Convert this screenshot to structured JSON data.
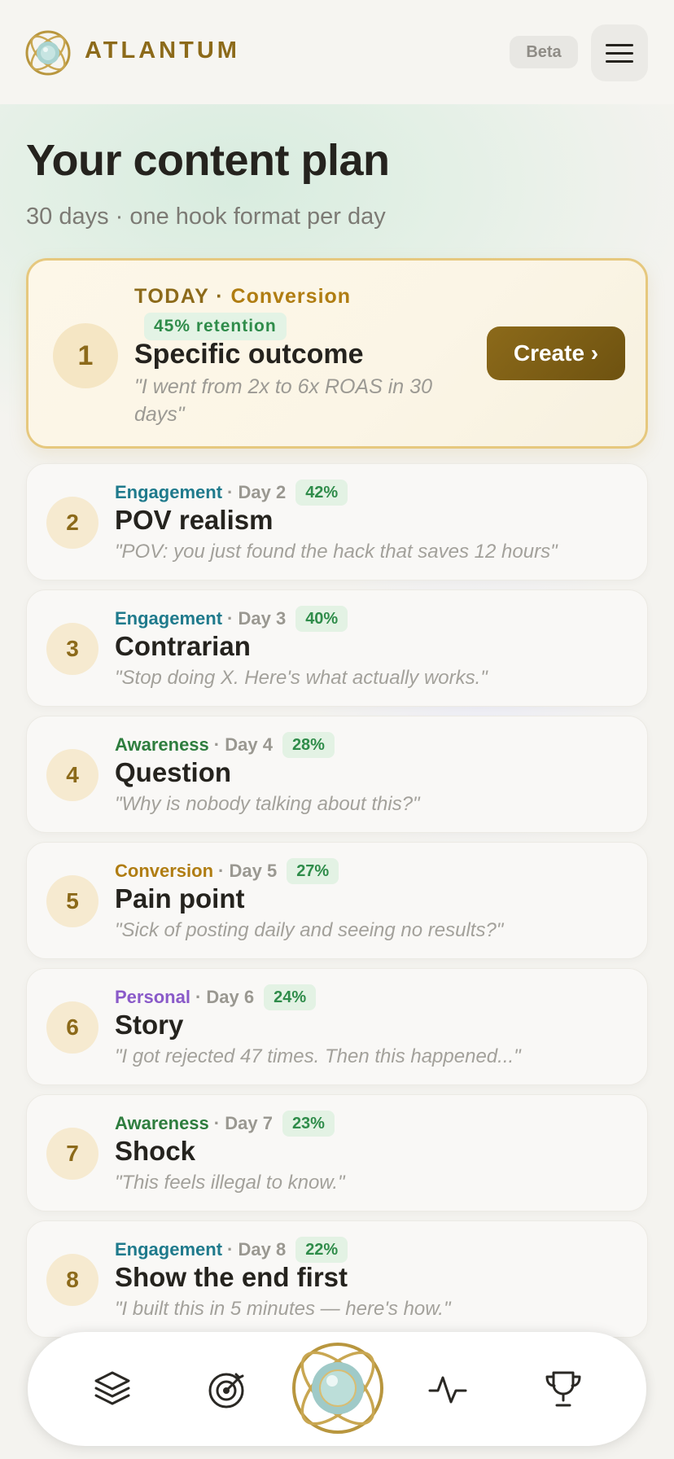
{
  "header": {
    "brand": "ATLANTUM",
    "beta_label": "Beta",
    "menu_icon": "hamburger-icon",
    "logo_icon": "atlantum-orb-logo"
  },
  "page": {
    "title": "Your content plan",
    "subtitle": "30 days · one hook format per day"
  },
  "today": {
    "number": "1",
    "label": "TODAY · ",
    "category": "Conversion",
    "retention": "45% retention",
    "name": "Specific outcome",
    "quote": "\"I went from 2x to 6x ROAS in 30 days\"",
    "cta": "Create ›"
  },
  "days": [
    {
      "number": "2",
      "category": "Engagement",
      "day": "· Day 2",
      "pct": "42%",
      "name": "POV realism",
      "quote": "\"POV: you just found the hack that saves 12 hours\""
    },
    {
      "number": "3",
      "category": "Engagement",
      "day": "· Day 3",
      "pct": "40%",
      "name": "Contrarian",
      "quote": "\"Stop doing X. Here's what actually works.\""
    },
    {
      "number": "4",
      "category": "Awareness",
      "day": "· Day 4",
      "pct": "28%",
      "name": "Question",
      "quote": "\"Why is nobody talking about this?\""
    },
    {
      "number": "5",
      "category": "Conversion",
      "day": "· Day 5",
      "pct": "27%",
      "name": "Pain point",
      "quote": "\"Sick of posting daily and seeing no results?\""
    },
    {
      "number": "6",
      "category": "Personal",
      "day": "· Day 6",
      "pct": "24%",
      "name": "Story",
      "quote": "\"I got rejected 47 times. Then this happened...\""
    },
    {
      "number": "7",
      "category": "Awareness",
      "day": "· Day 7",
      "pct": "23%",
      "name": "Shock",
      "quote": "\"This feels illegal to know.\""
    },
    {
      "number": "8",
      "category": "Engagement",
      "day": "· Day 8",
      "pct": "22%",
      "name": "Show the end first",
      "quote": "\"I built this in 5 minutes — here's how.\""
    }
  ],
  "nav": {
    "items": [
      "layers-icon",
      "target-icon",
      "atlantum-orb-icon",
      "activity-icon",
      "trophy-icon"
    ]
  },
  "colors": {
    "brand_gold": "#8c6a1a",
    "engagement": "#1f7a8c",
    "awareness": "#2e7d3e",
    "conversion": "#b07d12",
    "personal": "#8a5ac9",
    "retention_green": "#2f8c4a"
  }
}
